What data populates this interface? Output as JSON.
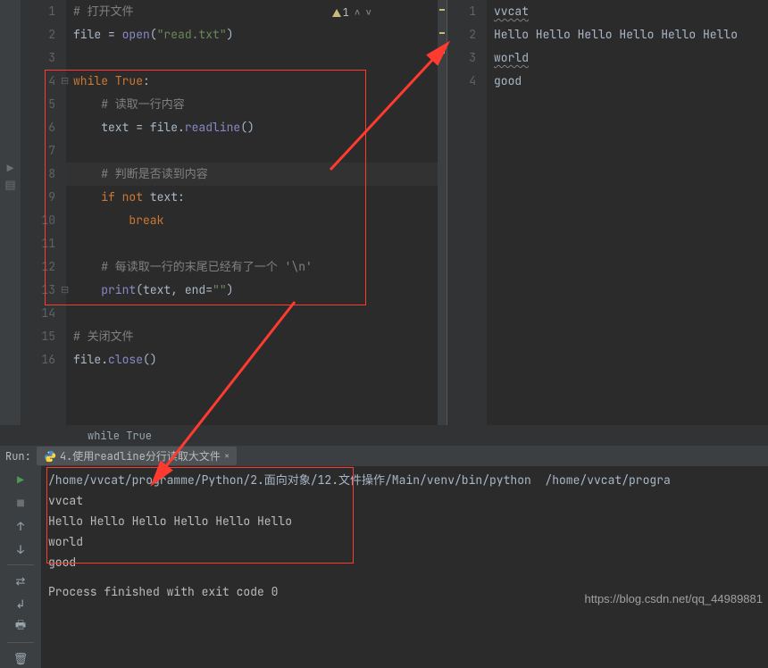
{
  "warnings": {
    "count": "1"
  },
  "editor": {
    "gutter": [
      "1",
      "2",
      "3",
      "4",
      "5",
      "6",
      "7",
      "8",
      "9",
      "10",
      "11",
      "12",
      "13",
      "14",
      "15",
      "16"
    ],
    "caret_line": 8,
    "lines": {
      "l1": {
        "cm": "# 打开文件"
      },
      "l2": {
        "p1": "file = ",
        "fn": "open",
        "p2": "(",
        "str": "\"read.txt\"",
        "p3": ")"
      },
      "l3": {
        "blank": ""
      },
      "l4": {
        "kw1": "while ",
        "kw2": "True",
        "p": ":"
      },
      "l5": {
        "cm": "# 读取一行内容"
      },
      "l6": {
        "p1": "text = file.",
        "fn": "readline",
        "p2": "()"
      },
      "l7": {
        "blank": ""
      },
      "l8": {
        "cm": "# 判断是否读到内容"
      },
      "l9": {
        "kw1": "if ",
        "kw2": "not ",
        "id": "text",
        "p": ":"
      },
      "l10": {
        "kw": "break"
      },
      "l11": {
        "blank": ""
      },
      "l12": {
        "cm": "# 每读取一行的末尾已经有了一个 '\\n'"
      },
      "l13": {
        "fn": "print",
        "p1": "(text, ",
        "id": "end",
        "p2": "=",
        "str": "\"\"",
        "p3": ")"
      },
      "l14": {
        "blank": ""
      },
      "l15": {
        "cm": "# 关闭文件"
      },
      "l16": {
        "p1": "file.",
        "fn": "close",
        "p2": "()"
      }
    },
    "breadcrumb": "while True"
  },
  "preview": {
    "gutter": [
      "1",
      "2",
      "3",
      "4"
    ],
    "lines": [
      "vvcat",
      "Hello Hello Hello Hello Hello Hello",
      "world",
      "good"
    ]
  },
  "run": {
    "panel_label": "Run:",
    "tab_label": "4.使用readline分行读取大文件",
    "command": "/home/vvcat/programme/Python/2.面向对象/12.文件操作/Main/venv/bin/python  /home/vvcat/progra",
    "output": [
      "vvcat",
      "Hello Hello Hello Hello Hello Hello",
      "world",
      "good"
    ],
    "exit": "Process finished with exit code 0"
  },
  "watermark": "https://blog.csdn.net/qq_44989881"
}
